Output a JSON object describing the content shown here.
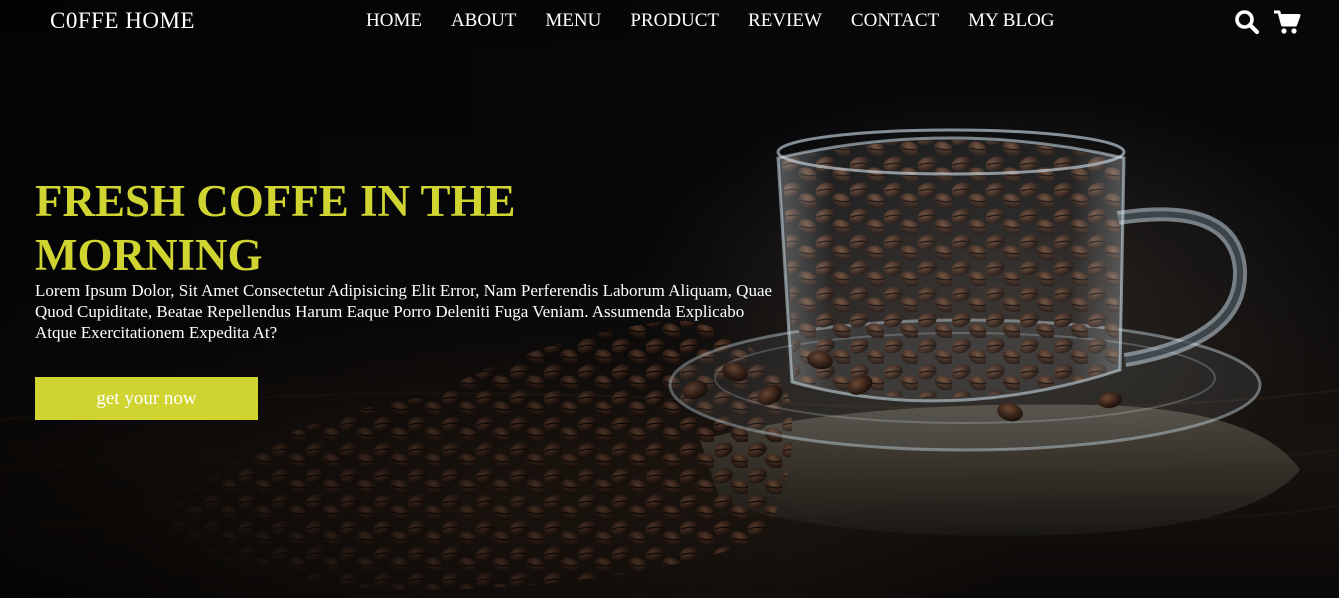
{
  "brand": {
    "logo_text": "C0FFE HOME"
  },
  "nav": {
    "items": [
      {
        "label": "HOME"
      },
      {
        "label": "ABOUT"
      },
      {
        "label": "MENU"
      },
      {
        "label": "PRODUCT"
      },
      {
        "label": "REVIEW"
      },
      {
        "label": "CONTACT"
      },
      {
        "label": "MY BLOG"
      }
    ]
  },
  "header_icons": {
    "search": "search-icon",
    "cart": "cart-icon"
  },
  "hero": {
    "title": "FRESH COFFE IN THE MORNING",
    "description": "Lorem Ipsum Dolor, Sit Amet Consectetur Adipisicing Elit Error, Nam Perferendis Laborum Aliquam, Quae Quod Cupiditate, Beatae Repellendus Harum Eaque Porro Deleniti Fuga Veniam. Assumenda Explicabo Atque Exercitationem Expedita At?",
    "cta_label": "get your now",
    "background_image": "coffee beans in glass cup on saucer"
  },
  "colors": {
    "accent": "#cfd431",
    "text": "#ffffff",
    "background": "#050506"
  }
}
